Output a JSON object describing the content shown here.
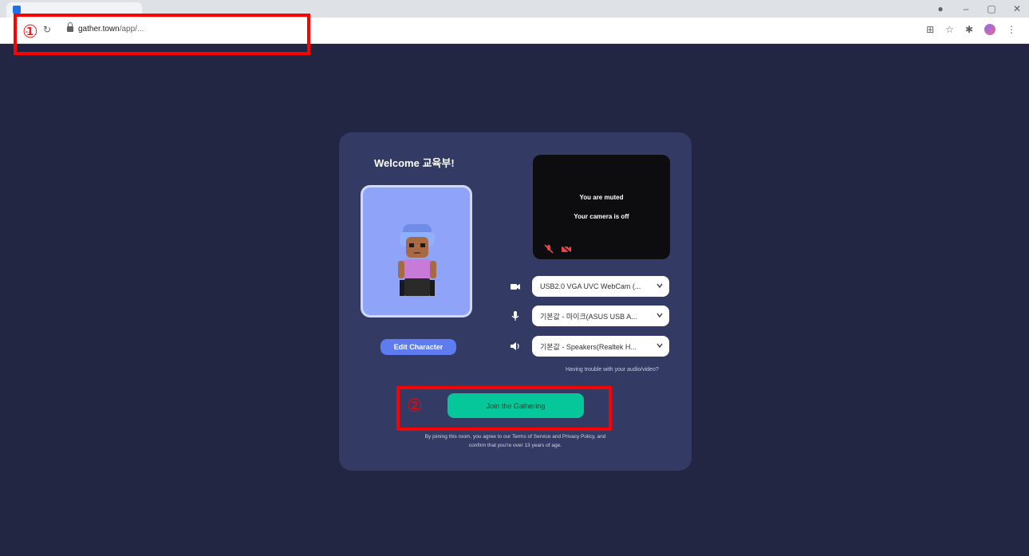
{
  "browser": {
    "tab_title": "",
    "url_host": "gather.town",
    "url_path": "/app/...",
    "window_controls": {
      "minimize": "–",
      "maximize": "▢",
      "close": "✕"
    }
  },
  "card": {
    "welcome": "Welcome 교육부!",
    "edit_character": "Edit Character",
    "preview": {
      "muted": "You are muted",
      "camera_off": "Your camera is off"
    },
    "devices": {
      "camera": "USB2.0 VGA UVC WebCam (...",
      "mic": "기본값 - 마이크(ASUS USB A...",
      "speaker": "기본값 - Speakers(Realtek H..."
    },
    "trouble": "Having trouble with your audio/video?",
    "join": "Join the Gathering",
    "terms": "By joining this room, you agree to our Terms of Service and Privacy Policy, and confirm that you're over 13 years of age."
  },
  "annotations": {
    "one": "①",
    "two": "②"
  },
  "colors": {
    "page_bg": "#232643",
    "card_bg": "#333a64",
    "join": "#05c799",
    "annotation": "#ff0000"
  }
}
